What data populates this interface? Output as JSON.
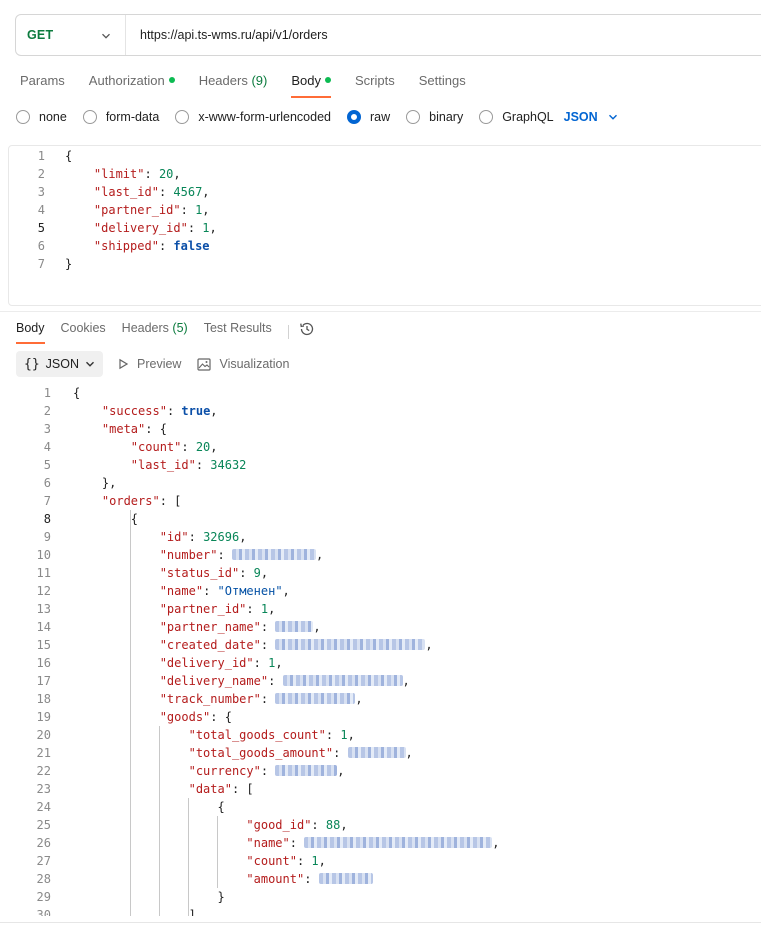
{
  "request": {
    "method": "GET",
    "url": "https://api.ts-wms.ru/api/v1/orders",
    "method_color": "#0c7b3e"
  },
  "tabs": [
    {
      "label": "Params",
      "active": false,
      "dot": false
    },
    {
      "label": "Authorization",
      "active": false,
      "dot": true
    },
    {
      "label": "Headers",
      "count": "(9)",
      "active": false,
      "dot": false
    },
    {
      "label": "Body",
      "active": true,
      "dot": true
    },
    {
      "label": "Scripts",
      "active": false,
      "dot": false
    },
    {
      "label": "Settings",
      "active": false,
      "dot": false
    }
  ],
  "body_types": {
    "options": [
      "none",
      "form-data",
      "x-www-form-urlencoded",
      "raw",
      "binary",
      "GraphQL"
    ],
    "selected": "raw",
    "language": "JSON"
  },
  "request_body": [
    "{",
    "    \"limit\": 20,",
    "    \"last_id\": 4567,",
    "    \"partner_id\": 1,",
    "    \"delivery_id\": 1,",
    "    \"shipped\": false",
    "}"
  ],
  "response_tabs": [
    {
      "label": "Body",
      "active": true
    },
    {
      "label": "Cookies",
      "active": false
    },
    {
      "label": "Headers",
      "count": "(5)",
      "active": false
    },
    {
      "label": "Test Results",
      "active": false
    }
  ],
  "response_toolbar": {
    "format": "JSON",
    "preview": "Preview",
    "visualization": "Visualization"
  },
  "response_body": [
    "{",
    "    \"success\": true,",
    "    \"meta\": {",
    "        \"count\": 20,",
    "        \"last_id\": 34632",
    "    },",
    "    \"orders\": [",
    "        {",
    "            \"id\": 32696,",
    "            \"number\": [redacted],",
    "            \"status_id\": 9,",
    "            \"name\": \"Отменен\",",
    "            \"partner_id\": 1,",
    "            \"partner_name\": [redacted],",
    "            \"created_date\": [redacted],",
    "            \"delivery_id\": 1,",
    "            \"delivery_name\": [redacted],",
    "            \"track_number\": [redacted],",
    "            \"goods\": {",
    "                \"total_goods_count\": 1,",
    "                \"total_goods_amount\": [redacted],",
    "                \"currency\": [redacted],",
    "                \"data\": [",
    "                    {",
    "                        \"good_id\": 88,",
    "                        \"name\": [redacted],",
    "                        \"count\": 1,",
    "                        \"amount\": [redacted]",
    "                    }",
    "                ]"
  ],
  "colors": {
    "accent": "#ff6c37",
    "radio_selected": "#0265d2",
    "json_key": "#b41c1c",
    "json_number": "#098658",
    "json_string": "#0451a5"
  }
}
